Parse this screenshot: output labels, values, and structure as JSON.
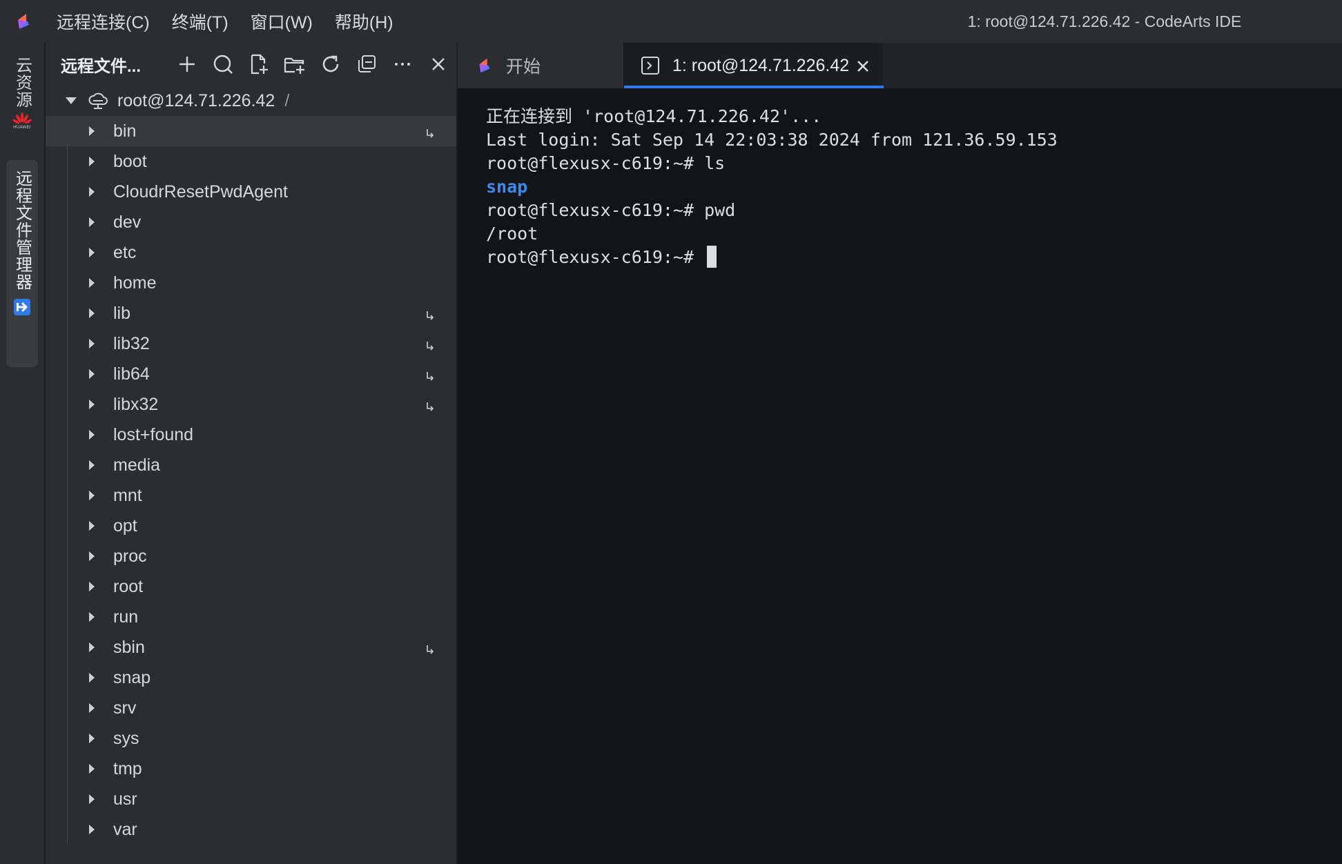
{
  "menu": {
    "items": [
      {
        "label": "远程连接(C)"
      },
      {
        "label": "终端(T)"
      },
      {
        "label": "窗口(W)"
      },
      {
        "label": "帮助(H)"
      }
    ]
  },
  "window_title": "1: root@124.71.226.42 - CodeArts IDE",
  "activity_bar": {
    "cloud_label": "云资源",
    "remote_label": "远程文件管理器",
    "huawei_text": "HUAWEI"
  },
  "sidebar": {
    "title": "远程文件...",
    "root": {
      "label": "root@124.71.226.42",
      "path": "/"
    },
    "items": [
      {
        "name": "bin",
        "link": true
      },
      {
        "name": "boot",
        "link": false
      },
      {
        "name": "CloudrResetPwdAgent",
        "link": false
      },
      {
        "name": "dev",
        "link": false
      },
      {
        "name": "etc",
        "link": false
      },
      {
        "name": "home",
        "link": false
      },
      {
        "name": "lib",
        "link": true
      },
      {
        "name": "lib32",
        "link": true
      },
      {
        "name": "lib64",
        "link": true
      },
      {
        "name": "libx32",
        "link": true
      },
      {
        "name": "lost+found",
        "link": false
      },
      {
        "name": "media",
        "link": false
      },
      {
        "name": "mnt",
        "link": false
      },
      {
        "name": "opt",
        "link": false
      },
      {
        "name": "proc",
        "link": false
      },
      {
        "name": "root",
        "link": false
      },
      {
        "name": "run",
        "link": false
      },
      {
        "name": "sbin",
        "link": true
      },
      {
        "name": "snap",
        "link": false
      },
      {
        "name": "srv",
        "link": false
      },
      {
        "name": "sys",
        "link": false
      },
      {
        "name": "tmp",
        "link": false
      },
      {
        "name": "usr",
        "link": false
      },
      {
        "name": "var",
        "link": false
      }
    ]
  },
  "tabs": [
    {
      "label": "开始"
    },
    {
      "label": "1: root@124.71.226.42"
    }
  ],
  "terminal": {
    "lines": [
      {
        "text": "正在连接到 'root@124.71.226.42'...",
        "style": "normal"
      },
      {
        "text": "Last login: Sat Sep 14 22:03:38 2024 from 121.36.59.153",
        "style": "normal"
      },
      {
        "text": "root@flexusx-c619:~# ls",
        "style": "normal"
      },
      {
        "text": "snap",
        "style": "dir"
      },
      {
        "text": "root@flexusx-c619:~# pwd",
        "style": "normal"
      },
      {
        "text": "/root",
        "style": "normal"
      },
      {
        "text": "root@flexusx-c619:~# ",
        "style": "prompt"
      }
    ]
  },
  "colors": {
    "accent": "#2e7bf0",
    "directory": "#3b8cf2",
    "terminal_bg": "#131417",
    "panel_bg": "#2b2d30"
  }
}
